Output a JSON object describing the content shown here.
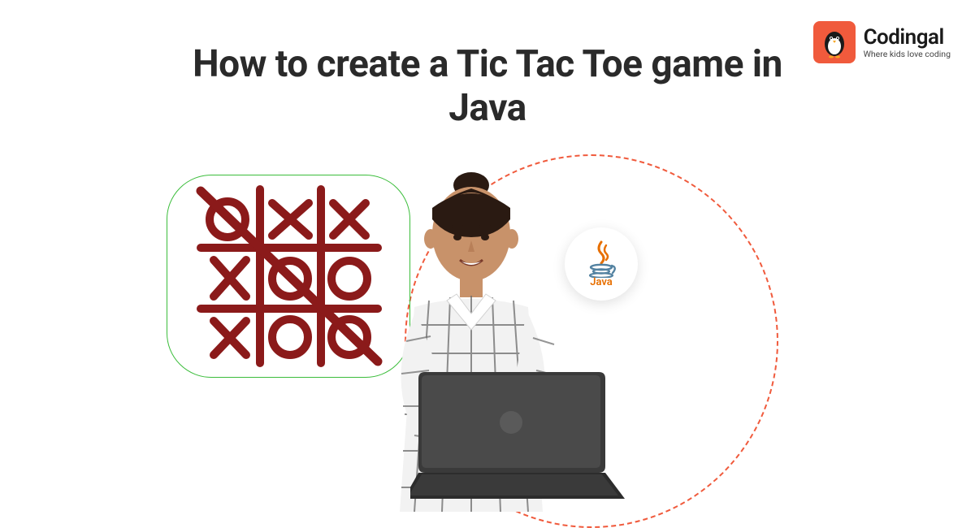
{
  "brand": {
    "name": "Codingal",
    "tagline": "Where kids love coding",
    "icon_name": "penguin-icon"
  },
  "title": "How to create a Tic Tac Toe game in Java",
  "illustration": {
    "tictactoe": {
      "grid": [
        [
          "O",
          "X",
          "X"
        ],
        [
          "X",
          "O",
          "O"
        ],
        [
          "X",
          "O",
          "O"
        ]
      ],
      "win_line": "diagonal-tl-br",
      "stroke_color": "#8b1a1a"
    },
    "java_badge": {
      "label": "Java",
      "icon_name": "java-icon"
    },
    "person_alt": "student holding laptop",
    "accent_circle_color": "#f05a3c",
    "green_box_color": "#3bbd3b"
  }
}
